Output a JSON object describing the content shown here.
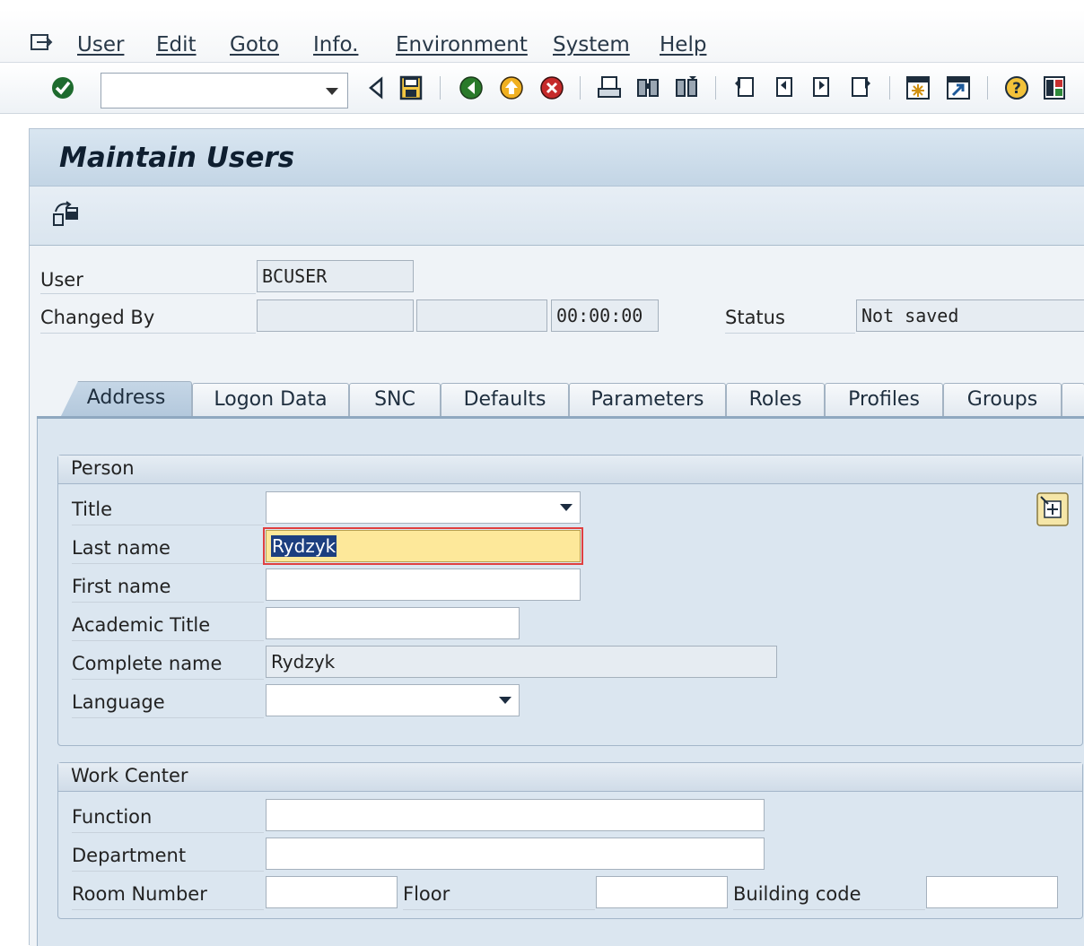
{
  "menu": {
    "items": [
      "User",
      "Edit",
      "Goto",
      "Info.",
      "Environment",
      "System",
      "Help"
    ]
  },
  "toolbar": {
    "command_field": "",
    "icons": [
      "enter-check",
      "back-arrow",
      "save",
      "back",
      "exit",
      "cancel",
      "print",
      "find",
      "find-next",
      "first-page",
      "previous-page",
      "next-page",
      "last-page",
      "create-session",
      "shortcut",
      "help",
      "customize-layout"
    ]
  },
  "page": {
    "title": "Maintain Users"
  },
  "header_fields": {
    "user_label": "User",
    "user_value": "BCUSER",
    "changed_by_label": "Changed By",
    "changed_by_value": "",
    "changed_date": "",
    "changed_time": "00:00:00",
    "status_label": "Status",
    "status_value": "Not saved"
  },
  "tabs": [
    "Address",
    "Logon Data",
    "SNC",
    "Defaults",
    "Parameters",
    "Roles",
    "Profiles",
    "Groups"
  ],
  "active_tab": "Address",
  "person": {
    "heading": "Person",
    "title_label": "Title",
    "title_value": "",
    "last_name_label": "Last name",
    "last_name_value": "Rydzyk",
    "first_name_label": "First name",
    "first_name_value": "",
    "academic_title_label": "Academic Title",
    "academic_title_value": "",
    "complete_name_label": "Complete name",
    "complete_name_value": "Rydzyk",
    "language_label": "Language",
    "language_value": ""
  },
  "work_center": {
    "heading": "Work Center",
    "function_label": "Function",
    "function_value": "",
    "department_label": "Department",
    "department_value": "",
    "room_number_label": "Room Number",
    "room_number_value": "",
    "floor_label": "Floor",
    "floor_value": "",
    "building_code_label": "Building code",
    "building_code_value": ""
  },
  "colors": {
    "accent": "#1c3f80",
    "focus_field": "#fde89a",
    "panel": "#dbe6f0"
  }
}
